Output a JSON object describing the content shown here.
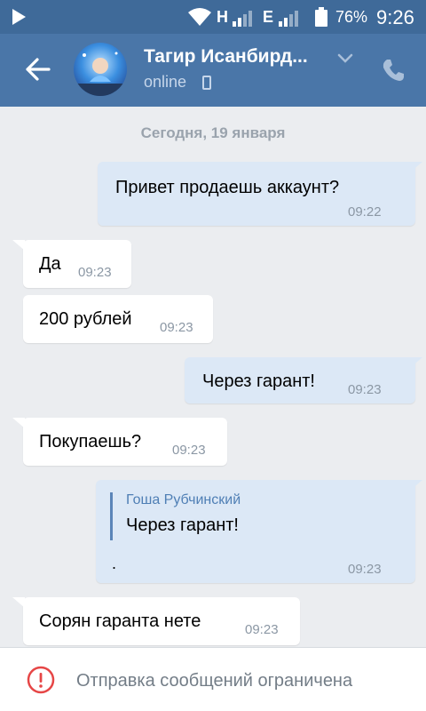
{
  "status_bar": {
    "net1": "H",
    "net2": "E",
    "battery": "76%",
    "time": "9:26"
  },
  "header": {
    "title": "Тагир Исанбирд...",
    "status": "online"
  },
  "chat": {
    "date": "Сегодня, 19 января",
    "messages": [
      {
        "text": "Привет продаешь аккаунт?",
        "time": "09:22",
        "direction": "out"
      },
      {
        "text": "Да",
        "time": "09:23",
        "direction": "in"
      },
      {
        "text": "200 рублей",
        "time": "09:23",
        "direction": "in"
      },
      {
        "text": "Через гарант!",
        "time": "09:23",
        "direction": "out"
      },
      {
        "text": "Покупаешь?",
        "time": "09:23",
        "direction": "in"
      },
      {
        "forward_author": "Гоша Рубчинский",
        "forward_text": "Через гарант!",
        "extra": ".",
        "time": "09:23",
        "direction": "out"
      },
      {
        "text": "Сорян гаранта нете",
        "time": "09:23",
        "direction": "in"
      }
    ]
  },
  "bottom": {
    "notice": "Отправка сообщений ограничена"
  },
  "colors": {
    "header": "#4a76a8",
    "status_bar": "#3f6a99",
    "out_bubble": "#dce8f6",
    "in_bubble": "#ffffff",
    "background": "#ebedf0",
    "warning": "#e64646"
  },
  "icons": {
    "back": "arrow-left-icon",
    "chevron": "chevron-down-icon",
    "call": "phone-icon",
    "warning": "exclamation-circle-icon"
  }
}
